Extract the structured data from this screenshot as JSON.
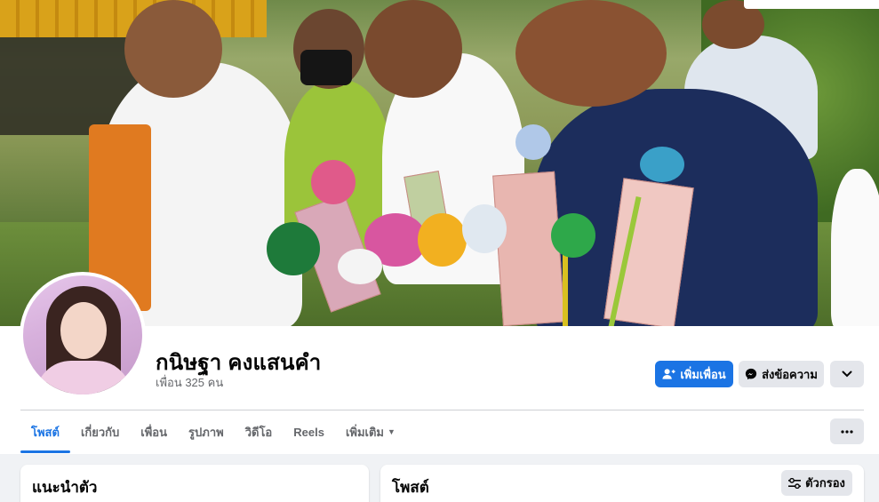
{
  "profile": {
    "name": "กนิษฐา คงแสนคำ",
    "friends_count": "เพื่อน 325 คน"
  },
  "actions": {
    "add_friend": "เพิ่มเพื่อน",
    "message": "ส่งข้อความ"
  },
  "tabs": [
    {
      "label": "โพสต์",
      "active": true
    },
    {
      "label": "เกี่ยวกับ",
      "active": false
    },
    {
      "label": "เพื่อน",
      "active": false
    },
    {
      "label": "รูปภาพ",
      "active": false
    },
    {
      "label": "วิดีโอ",
      "active": false
    },
    {
      "label": "Reels",
      "active": false
    },
    {
      "label": "เพิ่มเติม",
      "active": false
    }
  ],
  "sections": {
    "intro_title": "แนะนำตัว",
    "posts_title": "โพสต์",
    "filter_label": "ตัวกรอง"
  },
  "colors": {
    "accent": "#1b74e4",
    "button_gray": "#e4e6eb",
    "background": "#f0f2f5",
    "text_secondary": "#65676b"
  },
  "icons": [
    "add-friend-icon",
    "messenger-icon",
    "chevron-down-icon",
    "more-dots-icon",
    "filter-icon",
    "caret-down-icon"
  ]
}
